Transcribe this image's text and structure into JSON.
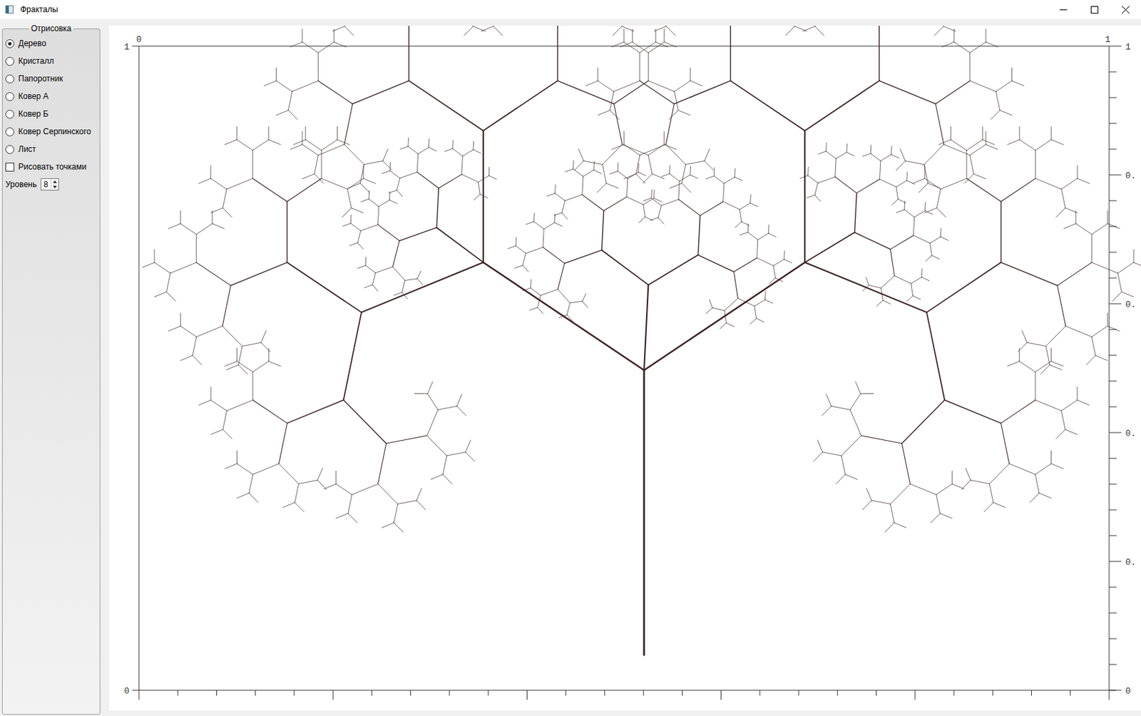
{
  "window": {
    "title": "Фракталы"
  },
  "panel": {
    "group_title": "Отрисовка",
    "radios": [
      {
        "label": "Дерево",
        "selected": true
      },
      {
        "label": "Кристалл",
        "selected": false
      },
      {
        "label": "Папоротник",
        "selected": false
      },
      {
        "label": "Ковер А",
        "selected": false
      },
      {
        "label": "Ковер Б",
        "selected": false
      },
      {
        "label": "Ковер Серпинского",
        "selected": false
      },
      {
        "label": "Лист",
        "selected": false
      }
    ],
    "checkbox": {
      "label": "Рисовать точками",
      "checked": false
    },
    "spinner": {
      "label": "Уровень",
      "value": "8"
    }
  },
  "chart": {
    "left_axis": [
      "1",
      "0"
    ],
    "top_axis": [
      "0",
      "1"
    ],
    "right_axis": [
      "1",
      "0.",
      "0.",
      "0.",
      "0.",
      "0"
    ]
  }
}
